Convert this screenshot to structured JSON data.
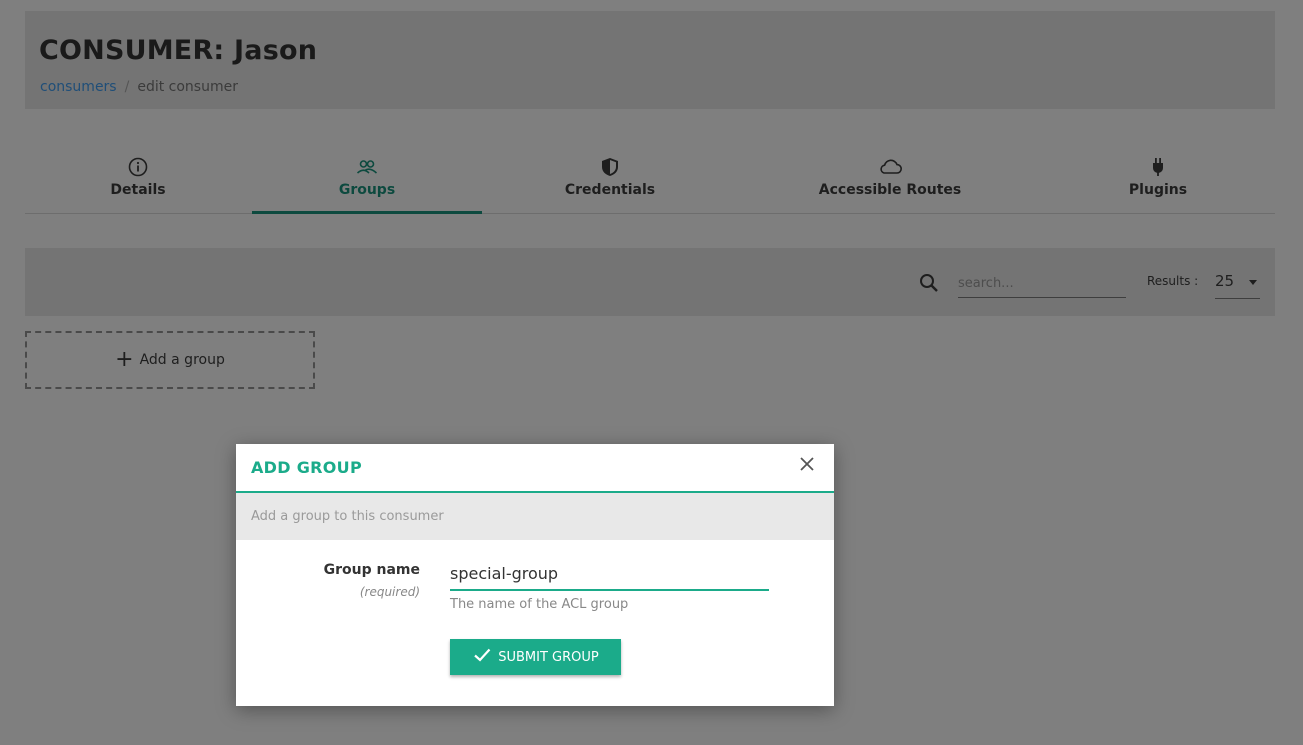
{
  "header": {
    "title": "CONSUMER: Jason",
    "breadcrumb": {
      "link": "consumers",
      "separator": "/",
      "current": "edit consumer"
    }
  },
  "tabs": [
    {
      "label": "Details",
      "icon": "info-icon"
    },
    {
      "label": "Groups",
      "icon": "users-icon",
      "active": true
    },
    {
      "label": "Credentials",
      "icon": "shield-icon"
    },
    {
      "label": "Accessible Routes",
      "icon": "cloud-icon"
    },
    {
      "label": "Plugins",
      "icon": "plug-icon"
    }
  ],
  "toolbar": {
    "search_placeholder": "search...",
    "results_label": "Results :",
    "results_value": "25"
  },
  "add_group_label": "Add a group",
  "modal": {
    "title": "ADD GROUP",
    "subtitle": "Add a group to this consumer",
    "field_label": "Group name",
    "field_required": "(required)",
    "field_value": "special-group",
    "field_help": "The name of the ACL group",
    "submit_label": "SUBMIT GROUP"
  },
  "colors": {
    "accent": "#1bab8a",
    "active_tab": "#0d4a3f",
    "link": "#1f4e78"
  }
}
